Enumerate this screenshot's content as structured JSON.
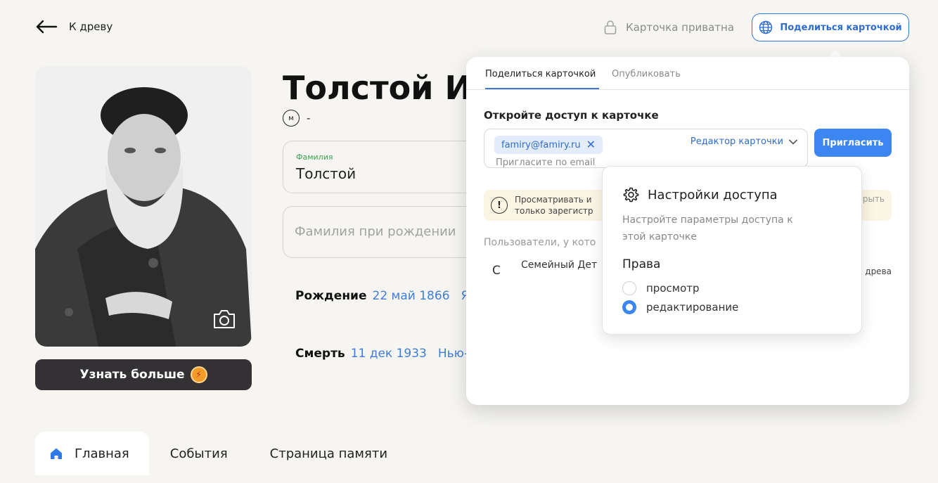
{
  "header": {
    "back_label": "К древу",
    "private_label": "Карточка приватна",
    "share_label": "Поделиться карточкой"
  },
  "profile": {
    "name": "Толстой Ил",
    "gender_badge": "м",
    "gender_dash": "-",
    "lastname_label": "Фамилия",
    "lastname_value": "Толстой",
    "birthname_placeholder": "Фамилия при рождении",
    "birth_label": "Рождение",
    "birth_date": "22 май 1866",
    "birth_place": "Яс",
    "death_label": "Смерть",
    "death_date": "11 дек 1933",
    "death_place": "Нью-Хе",
    "more_label": "Узнать больше"
  },
  "tabs": [
    {
      "label": "Главная"
    },
    {
      "label": "События"
    },
    {
      "label": "Страница памяти"
    }
  ],
  "share_popover": {
    "tabs": [
      {
        "label": "Поделиться карточкой"
      },
      {
        "label": "Опубликовать"
      }
    ],
    "title": "Откройте доступ к карточке",
    "chip_email": "famiry@famiry.ru",
    "invite_placeholder": "Пригласите по email",
    "role_label": "Редактор карточки",
    "invite_button": "Пригласить",
    "notice_line1": "Просматривать и",
    "notice_line2": "только зарегистр",
    "notice_right": "рыть",
    "users_title": "Пользователи, у кото",
    "user": {
      "avatar": "С",
      "name": "Семейный Дет",
      "sub": "",
      "role": "древа"
    }
  },
  "access_settings": {
    "title": "Настройки доступа",
    "description": "Настройте параметры доступа к этой карточке",
    "rights_label": "Права",
    "options": [
      {
        "label": "просмотр",
        "checked": false
      },
      {
        "label": "редактирование",
        "checked": true
      }
    ]
  },
  "colors": {
    "accent": "#3b86f0",
    "link": "#3f7ed8",
    "background": "#f6f5f2",
    "dark_button": "#333134"
  }
}
